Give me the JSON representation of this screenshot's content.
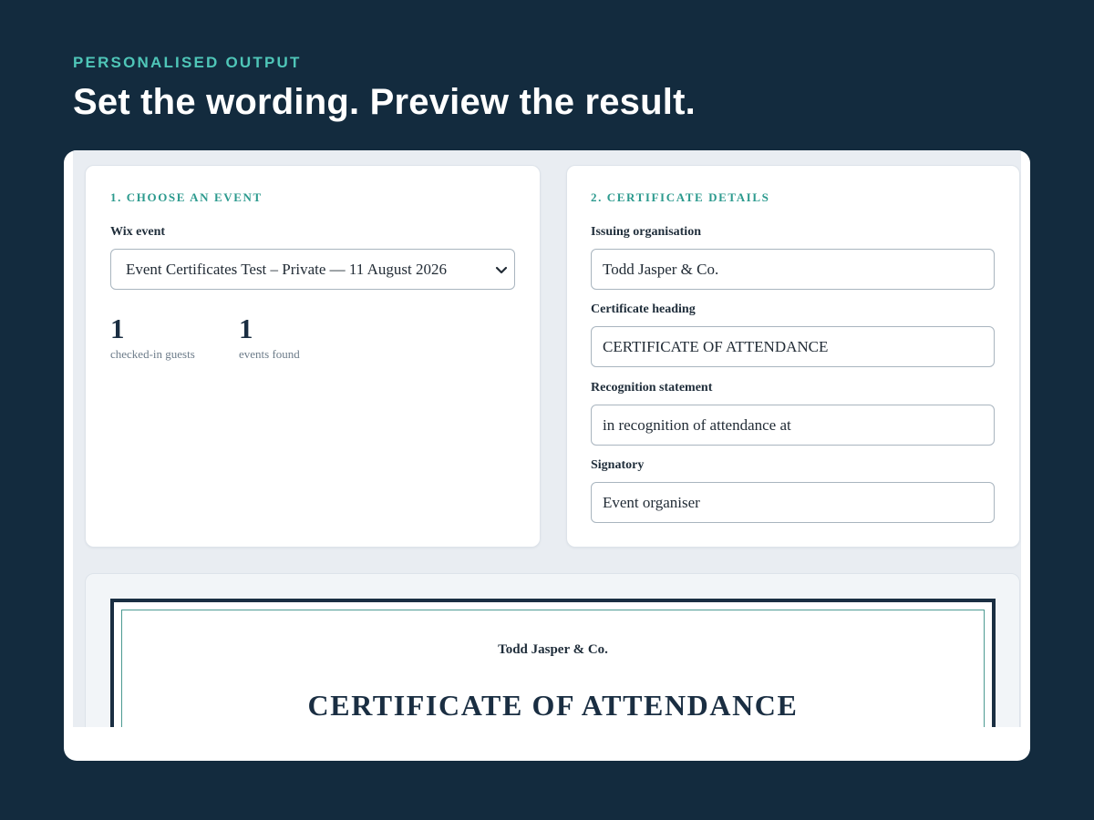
{
  "hero": {
    "eyebrow": "PERSONALISED OUTPUT",
    "headline": "Set the wording. Preview the result."
  },
  "choose_event": {
    "title": "1. CHOOSE AN EVENT",
    "event_label": "Wix event",
    "event_value": "Event Certificates Test – Private — 11 August 2026",
    "stats": [
      {
        "value": "1",
        "label": "checked-in guests"
      },
      {
        "value": "1",
        "label": "events found"
      }
    ]
  },
  "certificate_details": {
    "title": "2. CERTIFICATE DETAILS",
    "fields": [
      {
        "label": "Issuing organisation",
        "value": "Todd Jasper & Co."
      },
      {
        "label": "Certificate heading",
        "value": "CERTIFICATE OF ATTENDANCE"
      },
      {
        "label": "Recognition statement",
        "value": "in recognition of attendance at"
      },
      {
        "label": "Signatory",
        "value": "Event organiser"
      }
    ]
  },
  "preview": {
    "organisation": "Todd Jasper & Co.",
    "heading": "CERTIFICATE OF ATTENDANCE"
  },
  "colors": {
    "page_background": "#132b3e",
    "accent_teal": "#4fc6b8",
    "section_title_teal": "#2c9a8e",
    "navy": "#1a2e42"
  }
}
